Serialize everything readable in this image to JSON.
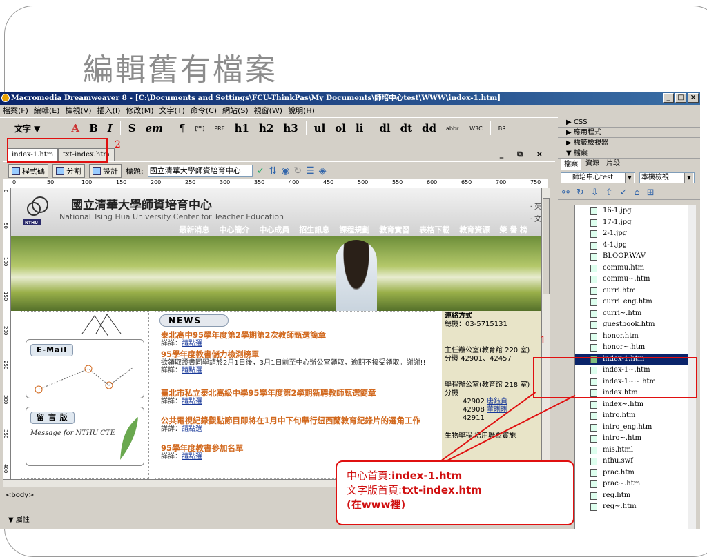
{
  "slide": {
    "title": "編輯舊有檔案"
  },
  "window": {
    "title": "Macromedia Dreamweaver 8 - [C:\\Documents and Settings\\FCU-ThinkPas\\My Documents\\師培中心test\\WWW\\index-1.htm]",
    "buttons": {
      "min": "_",
      "max": "□",
      "close": "×"
    }
  },
  "menu": [
    "檔案(F)",
    "編輯(E)",
    "檢視(V)",
    "插入(I)",
    "修改(M)",
    "文字(T)",
    "命令(C)",
    "網站(S)",
    "視窗(W)",
    "說明(H)"
  ],
  "toolbar": {
    "category": "文字 ▼",
    "items": [
      "A",
      "B",
      "I",
      "S",
      "em",
      "¶",
      "[\"\"]",
      "PRE",
      "h1",
      "h2",
      "h3",
      "ul",
      "ol",
      "li",
      "dl",
      "dt",
      "dd",
      "abbr.",
      "W3C",
      "BR"
    ]
  },
  "doc": {
    "tabs": [
      "index-1.htm",
      "txt-index.htm"
    ],
    "win_controls": "_ ⧉ ×",
    "view_buttons": [
      "程式碼",
      "分割",
      "設計"
    ],
    "title_label": "標題:",
    "title_value": "國立清華大學師資培育中心"
  },
  "ruler": {
    "h": [
      "0",
      "50",
      "100",
      "150",
      "200",
      "250",
      "300",
      "350",
      "400",
      "450",
      "500",
      "550",
      "600",
      "650",
      "700",
      "750"
    ],
    "v": [
      "0",
      "50",
      "100",
      "150",
      "200",
      "250",
      "300",
      "350",
      "400"
    ]
  },
  "site": {
    "title": "國立清華大學師資培育中心",
    "subtitle": "National Tsing Hua University Center for Teacher Education",
    "logo_text": "NTHU",
    "right1": "· 英",
    "right2": "· 文",
    "nav": [
      "最新消息",
      "中心簡介",
      "中心成員",
      "招生訊息",
      "課程規劃",
      "教育實習",
      "表格下載",
      "教育資源",
      "榮 譽 榜"
    ],
    "email_label": "E-Mail",
    "guestbook_label": "留 言 版",
    "guestbook_sub": "Message for NTHU CTE",
    "news_label": "NEWS",
    "news": [
      {
        "title": "泰北高中95學年度第2學期第2次教師甄選簡章",
        "detail_prefix": "詳詳：",
        "link": "請點選",
        "extra": ""
      },
      {
        "title": "95學年度教書儲力檢測榜單",
        "detail_prefix": "詳詳：",
        "link": "請點選",
        "extra": "欲領取證書同學請於2月1日後，3月1日前至中心辦公室領取，逾期不接受領取。謝謝!!"
      },
      {
        "title": "臺北市私立泰北高級中學95學年度第2學期新聘教師甄選簡章",
        "detail_prefix": "詳詳：",
        "link": "請點選",
        "extra": ""
      },
      {
        "title": "公共電視紀錄觀點節目即將在1月中下旬舉行紐西蘭教育紀錄片的選角工作",
        "detail_prefix": "詳詳：",
        "link": "請點選",
        "extra": ""
      },
      {
        "title": "95學年度教書參加名單",
        "detail_prefix": "詳詳：",
        "link": "請點選",
        "extra": ""
      }
    ],
    "contact": {
      "title": "連絡方式",
      "fax": "總機：03-5715131",
      "office": "主任辦公室(教育館 220 室)",
      "office_ext": "分機 42901、42457",
      "office2": "學程辦公室(教育館 218 室)",
      "office2_ext": "分機",
      "exts": [
        "42902",
        "42908",
        "42911"
      ],
      "ext_links": [
        "唐鈺貞",
        "董琍琍",
        ""
      ],
      "bottom": "生物學程 培用聯盟實施"
    }
  },
  "status": {
    "tag": "<body>"
  },
  "props": {
    "label": "▼ 屬性"
  },
  "panels": {
    "rows": [
      "▶ CSS",
      "▶ 應用程式",
      "▶ 標籤檢視器",
      "▼ 檔案"
    ],
    "tabs": [
      "檔案",
      "資源",
      "片段"
    ],
    "site_select": "師培中心test",
    "view_select": "本機檢視"
  },
  "files": [
    "16-1.jpg",
    "17-1.jpg",
    "2-1.jpg",
    "4-1.jpg",
    "BLOOP.WAV",
    "commu.htm",
    "commu~.htm",
    "curri.htm",
    "curri_eng.htm",
    "curri~.htm",
    "guestbook.htm",
    "honor.htm",
    "honor~.htm",
    "index-1.htm",
    "index-1~.htm",
    "index-1~~.htm",
    "index.htm",
    "index~.htm",
    "intro.htm",
    "intro_eng.htm",
    "intro~.htm",
    "mis.html",
    "nthu.swf",
    "prac.htm",
    "prac~.htm",
    "reg.htm",
    "reg~.htm"
  ],
  "selected_file": "index-1.htm",
  "annotations": {
    "label1": "1",
    "label2": "2",
    "callout": {
      "line1_prefix": "中心首頁:",
      "line1_value": "index-1.htm",
      "line2_prefix": "文字版首頁:",
      "line2_value": "txt-index.htm",
      "line3": "(在www裡)"
    }
  },
  "colors": {
    "accent_red": "#e01010",
    "titlebar": "#0a246a",
    "news_title": "#d2691e"
  }
}
